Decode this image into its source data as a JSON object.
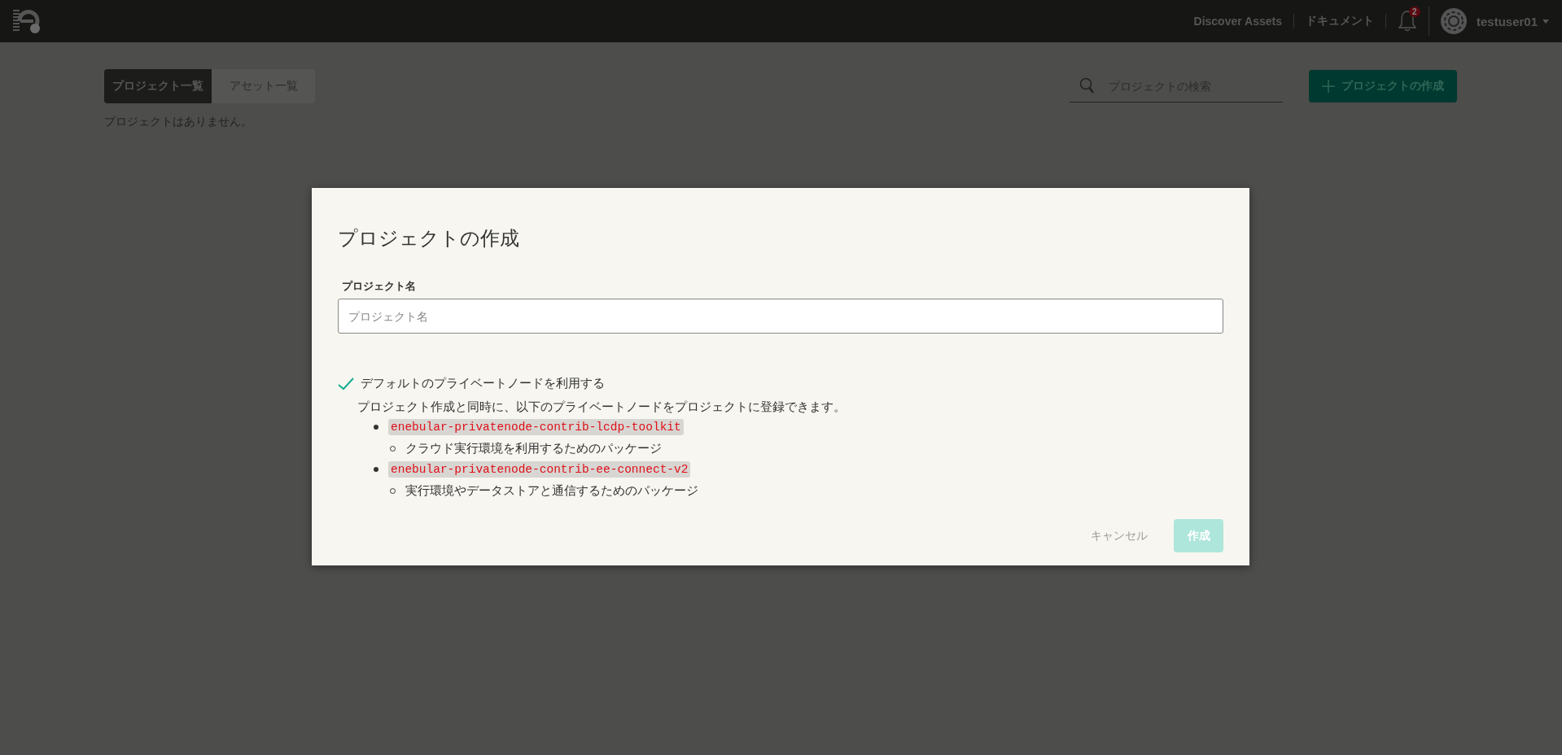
{
  "header": {
    "nav_links": [
      "Discover Assets",
      "ドキュメント"
    ],
    "notification_count": "2",
    "user": "testuser01"
  },
  "tabs": [
    {
      "label": "プロジェクト一覧",
      "selected": true
    },
    {
      "label": "アセット一覧",
      "selected": false
    }
  ],
  "search": {
    "placeholder": "プロジェクトの検索"
  },
  "create_button": "プロジェクトの作成",
  "empty_message": "プロジェクトはありません。",
  "dialog": {
    "title": "プロジェクトの作成",
    "field": {
      "label": "プロジェクト名",
      "placeholder": "プロジェクト名"
    },
    "checkbox": {
      "label": "デフォルトのプライベートノードを利用する",
      "checked": true
    },
    "description": "プロジェクト作成と同時に、以下のプライベートノードをプロジェクトに登録できます。",
    "packages": [
      {
        "name": "enebular-privatenode-contrib-lcdp-toolkit",
        "children": [
          {
            "text": "クラウド実行環境を利用するためのパッケージ"
          }
        ]
      },
      {
        "name": "enebular-privatenode-contrib-ee-connect-v2",
        "children": [
          {
            "text": "実行環境やデータストアと通信するためのパッケージ"
          }
        ]
      }
    ],
    "cancel": "キャンセル",
    "submit": {
      "label": "作成",
      "disabled": true
    }
  }
}
